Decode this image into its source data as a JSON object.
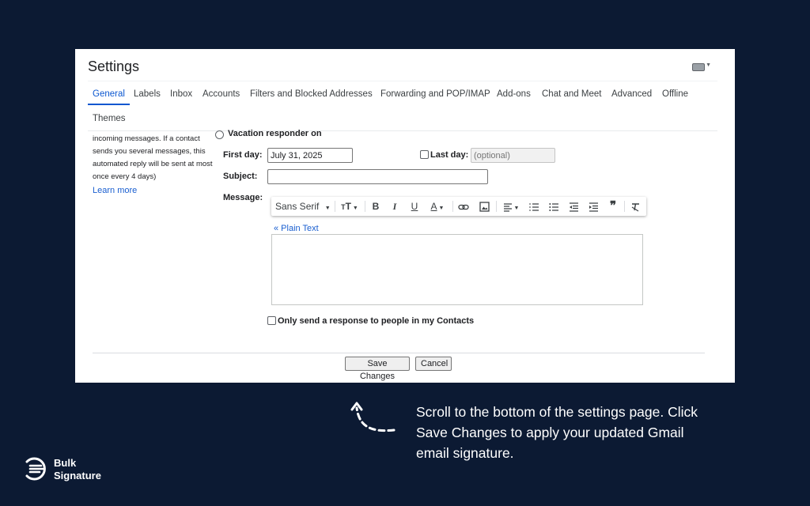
{
  "settings": {
    "title": "Settings",
    "tabs": [
      "General",
      "Labels",
      "Inbox",
      "Accounts",
      "Filters and Blocked Addresses",
      "Forwarding and POP/IMAP",
      "Add-ons",
      "Chat and Meet",
      "Advanced",
      "Offline",
      "Themes"
    ],
    "active_tab": "General"
  },
  "side": {
    "description": "incoming messages. If a contact sends you several messages, this automated reply will be sent at most once every 4 days)",
    "learn_more": "Learn more"
  },
  "vacation": {
    "radio_label": "Vacation responder on",
    "first_day_label": "First day:",
    "first_day_value": "July 31, 2025",
    "last_day_label": "Last day:",
    "last_day_placeholder": "(optional)",
    "subject_label": "Subject:",
    "subject_value": "",
    "message_label": "Message:",
    "plain_text_link": "« Plain Text",
    "only_contacts_label": "Only send a response to people in my Contacts"
  },
  "toolbar": {
    "font": "Sans Serif",
    "icons": [
      "font-size-icon",
      "bold-icon",
      "italic-icon",
      "underline-icon",
      "text-color-icon",
      "link-icon",
      "image-icon",
      "align-icon",
      "numbered-list-icon",
      "bulleted-list-icon",
      "indent-less-icon",
      "indent-more-icon",
      "quote-icon",
      "remove-formatting-icon"
    ]
  },
  "buttons": {
    "save": "Save Changes",
    "cancel": "Cancel"
  },
  "caption": "Scroll to the bottom of the settings page. Click Save Changes to apply your updated Gmail email signature.",
  "brand": {
    "line1": "Bulk",
    "line2": "Signature"
  },
  "colors": {
    "background": "#0c1a33",
    "accent_blue": "#0b57d0",
    "link_blue": "#1a5fd0"
  }
}
